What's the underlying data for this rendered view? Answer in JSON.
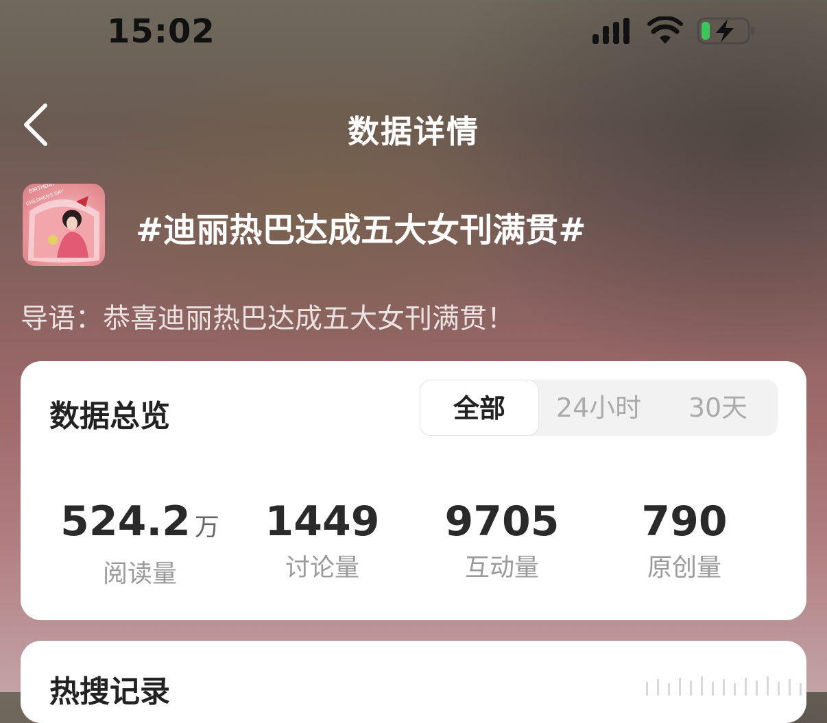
{
  "status_bar": {
    "time": "15:02"
  },
  "nav": {
    "title": "数据详情"
  },
  "topic": {
    "title": "#迪丽热巴达成五大女刊满贯#",
    "intro": "导语：恭喜迪丽热巴达成五大女刊满贯！",
    "avatar_text_top": "BIRTHDAY",
    "avatar_text_sub": "CHILDREN'S DAY"
  },
  "overview": {
    "title": "数据总览",
    "tabs": [
      {
        "label": "全部",
        "selected": true
      },
      {
        "label": "24小时",
        "selected": false
      },
      {
        "label": "30天",
        "selected": false
      }
    ],
    "stats": [
      {
        "value": "524.2",
        "unit": "万",
        "label": "阅读量"
      },
      {
        "value": "1449",
        "unit": "",
        "label": "讨论量"
      },
      {
        "value": "9705",
        "unit": "",
        "label": "互动量"
      },
      {
        "value": "790",
        "unit": "",
        "label": "原创量"
      }
    ]
  },
  "hot_search": {
    "title": "热搜记录"
  }
}
